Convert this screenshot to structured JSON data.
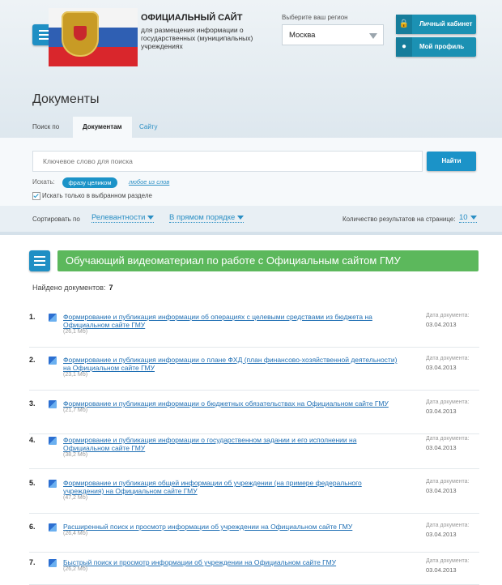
{
  "header": {
    "site_title": "ОФИЦИАЛЬНЫЙ САЙТ",
    "site_subtitle": "для размещения информации о государственных (муниципальных) учреждениях",
    "region_label": "Выберите ваш регион",
    "region_value": "Москва",
    "cabinet_label": "Личный кабинет",
    "profile_label": "Мой профиль"
  },
  "page": {
    "title": "Документы"
  },
  "tabs": [
    {
      "label": "Поиск по"
    },
    {
      "label": "Документам"
    },
    {
      "label": "Сайту"
    }
  ],
  "search": {
    "placeholder": "Ключевое слово для поиска",
    "button": "Найти",
    "mode_label": "Искать:",
    "mode_active": "фразу целиком",
    "mode_other": "любое из слов",
    "only_section": "Искать только в выбранном разделе"
  },
  "sort": {
    "label": "Сортировать по",
    "field": "Релевантности",
    "order": "В прямом порядке",
    "count_label": "Количество результатов на странице:",
    "count_value": "10"
  },
  "banner": {
    "text": "Обучающий видеоматериал по работе с Официальным сайтом ГМУ"
  },
  "results": {
    "found_label": "Найдено документов:",
    "found_count": "7",
    "date_label": "Дата документа:",
    "items": [
      {
        "num": "1.",
        "title": "Формирование и публикация информации об операциях с целевыми средствами из бюджета на Официальном сайте ГМУ",
        "size": "(26,1 Мб)",
        "date": "03.04.2013"
      },
      {
        "num": "2.",
        "title": "Формирование и публикация информации о плане ФХД (план финансово-хозяйственной деятельности) на Официальном сайте ГМУ",
        "size": "(23,1 Мб)",
        "date": "03.04.2013"
      },
      {
        "num": "3.",
        "title": "Формирование и публикация информации о бюджетных обязательствах на Официальном сайте ГМУ",
        "size": "(21,7 Мб)",
        "date": "03.04.2013"
      },
      {
        "num": "4.",
        "title": "Формирование и публикация информации о государственном задании и его исполнении на Официальном сайте ГМУ",
        "size": "(38,2 Мб)",
        "date": "03.04.2013"
      },
      {
        "num": "5.",
        "title": "Формирование и публикация общей информации об учреждении (на примере федерального учреждения) на Официальном сайте ГМУ",
        "size": "(47,2 Мб)",
        "date": "03.04.2013"
      },
      {
        "num": "6.",
        "title": "Расширенный поиск и просмотр информации об учреждении на Официальном сайте ГМУ",
        "size": "(26,4 Мб)",
        "date": "03.04.2013"
      },
      {
        "num": "7.",
        "title": "Быстрый поиск и просмотр информации об учреждении на Официальном сайте ГМУ",
        "size": "(26,2 Мб)",
        "date": "03.04.2013"
      }
    ]
  }
}
